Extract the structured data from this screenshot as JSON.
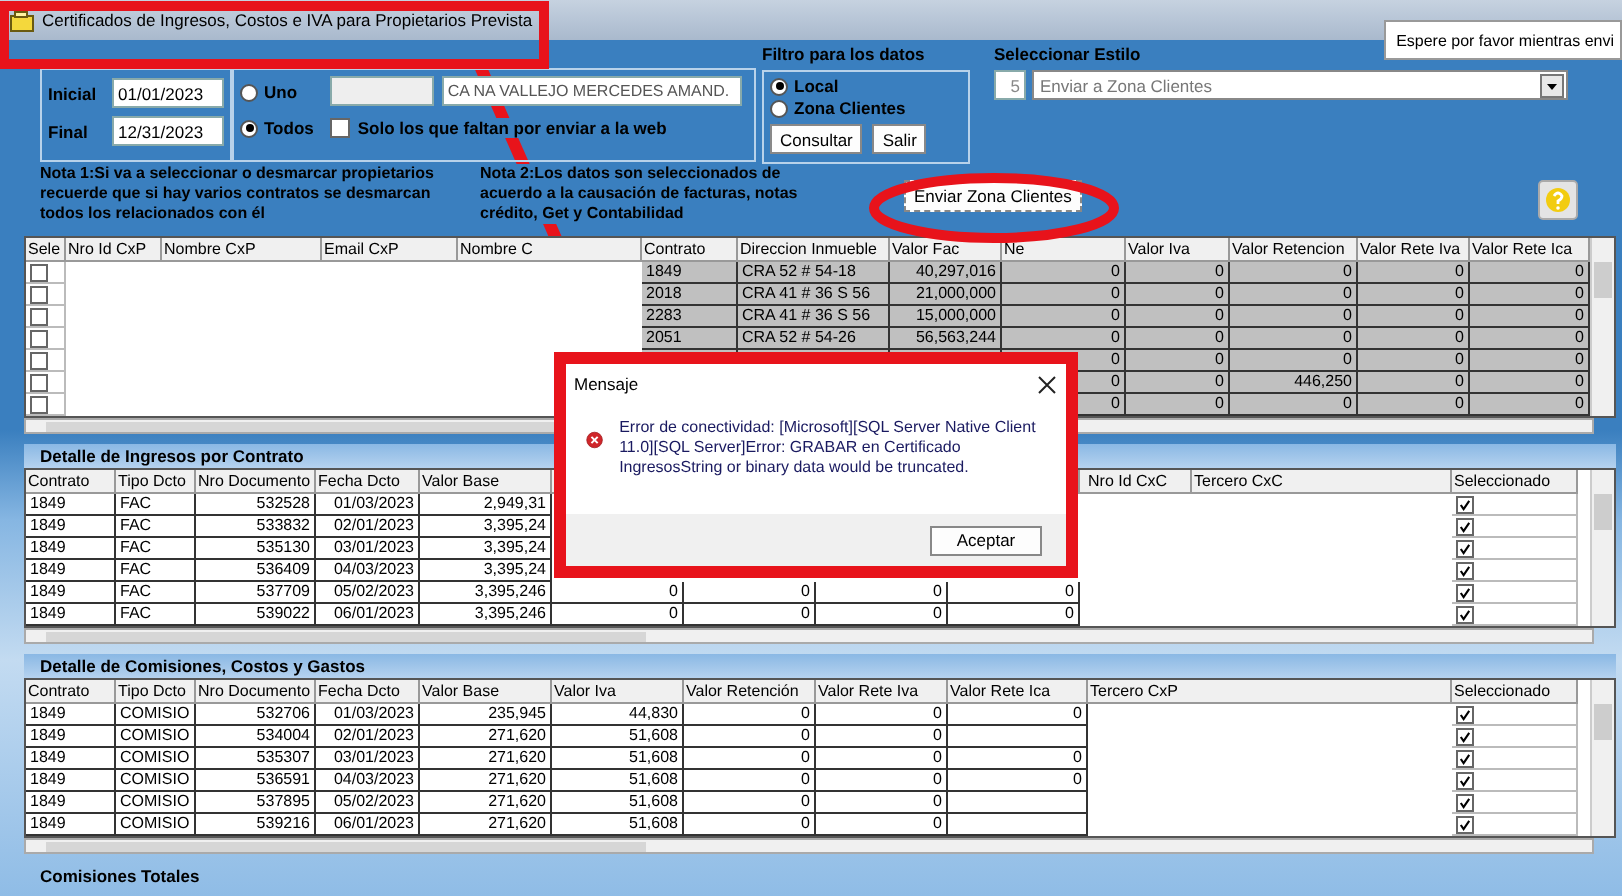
{
  "window": {
    "title": "Certificados de Ingresos, Costos e IVA para Propietarios Prevista"
  },
  "tooltip": "Espere por favor mientras envi",
  "dates": [
    {
      "label": "Inicial",
      "value": "01/01/2023"
    },
    {
      "label": "Final",
      "value": "12/31/2023"
    }
  ],
  "owner_scope": [
    {
      "label": "Uno",
      "selected": false
    },
    {
      "label": "Todos",
      "selected": true
    }
  ],
  "owner_name": {
    "value": "CA NA VALLEJO MERCEDES AMAND."
  },
  "pending_only": {
    "label": "Solo los que faltan  por enviar a la web",
    "checked": false
  },
  "filter": {
    "title": "Filtro para los datos",
    "options": [
      {
        "label": "Local",
        "selected": true
      },
      {
        "label": "Zona Clientes",
        "selected": false
      }
    ],
    "buttons": [
      "Consultar",
      "Salir"
    ]
  },
  "style": {
    "title": "Seleccionar Estilo",
    "number": "5",
    "value": "Enviar a Zona Clientes"
  },
  "notes": [
    "Nota 1:Si va a seleccionar o desmarcar propietarios recuerde que si hay varios contratos se desmarcan todos los relacionados con él",
    "Nota 2:Los datos son seleccionados de acuerdo a la causación de facturas, notas crédito, Get y Contabilidad"
  ],
  "send_button": "Enviar Zona Clientes",
  "owners_table": {
    "columns": [
      "Sele",
      "Nro Id CxP",
      "Nombre CxP",
      "Email CxP",
      "Nombre C",
      "Contrato",
      "Direccion Inmueble",
      "Valor Fac",
      "Ne",
      "Valor Iva",
      "Valor Retencion",
      "Valor Rete Iva",
      "Valor Rete Ica"
    ],
    "rows": [
      {
        "checked": false,
        "cells": [
          "",
          "",
          "",
          "",
          "",
          "1849",
          "CRA  52 # 54-18",
          "40,297,016",
          "0",
          "0",
          "0",
          "0",
          "0"
        ]
      },
      {
        "checked": false,
        "cells": [
          "",
          "",
          "",
          "",
          "",
          "2018",
          "CRA 41 # 36 S 56",
          "21,000,000",
          "0",
          "0",
          "0",
          "0",
          "0"
        ]
      },
      {
        "checked": false,
        "cells": [
          "",
          "",
          "",
          "",
          "",
          "2283",
          "CRA 41 # 36 S 56",
          "15,000,000",
          "0",
          "0",
          "0",
          "0",
          "0"
        ]
      },
      {
        "checked": false,
        "cells": [
          "",
          "",
          "",
          "",
          "",
          "2051",
          "CRA 52 # 54-26",
          "56,563,244",
          "0",
          "0",
          "0",
          "0",
          "0"
        ]
      },
      {
        "checked": false,
        "cells": [
          "",
          "",
          "",
          "",
          "",
          null,
          null,
          null,
          "0",
          "0",
          "0",
          "0",
          "0"
        ]
      },
      {
        "checked": false,
        "cells": [
          "",
          "",
          "",
          "",
          "",
          null,
          null,
          null,
          "0",
          "0",
          "446,250",
          "0",
          "0"
        ]
      },
      {
        "checked": false,
        "cells": [
          "",
          "",
          "",
          "",
          "",
          null,
          null,
          null,
          "0",
          "0",
          "0",
          "0",
          "0"
        ]
      }
    ]
  },
  "income_section": {
    "title": "Detalle de Ingresos por Contrato",
    "columns": [
      "Contrato",
      "Tipo Dcto",
      "Nro Documento",
      "Fecha Dcto",
      "Valor Base",
      null,
      null,
      null,
      null,
      "Nro Id CxC",
      "Tercero CxC",
      "Seleccionado"
    ],
    "rows": [
      {
        "checked": true,
        "cells": [
          "1849",
          "FAC",
          "532528",
          "01/03/2023",
          "2,949,31",
          null,
          null,
          null,
          null,
          "",
          ""
        ]
      },
      {
        "checked": true,
        "cells": [
          "1849",
          "FAC",
          "533832",
          "02/01/2023",
          "3,395,24",
          null,
          null,
          null,
          null,
          "",
          ""
        ]
      },
      {
        "checked": true,
        "cells": [
          "1849",
          "FAC",
          "535130",
          "03/01/2023",
          "3,395,24",
          null,
          null,
          null,
          null,
          "",
          ""
        ]
      },
      {
        "checked": true,
        "cells": [
          "1849",
          "FAC",
          "536409",
          "04/03/2023",
          "3,395,24",
          null,
          null,
          null,
          null,
          "",
          ""
        ]
      },
      {
        "checked": true,
        "cells": [
          "1849",
          "FAC",
          "537709",
          "05/02/2023",
          "3,395,246",
          "0",
          "0",
          "0",
          "0",
          "",
          ""
        ]
      },
      {
        "checked": true,
        "cells": [
          "1849",
          "FAC",
          "539022",
          "06/01/2023",
          "3,395,246",
          "0",
          "0",
          "0",
          "0",
          "",
          ""
        ]
      }
    ]
  },
  "costs_section": {
    "title": "Detalle de Comisiones, Costos y Gastos",
    "columns": [
      "Contrato",
      "Tipo Dcto",
      "Nro Documento",
      "Fecha Dcto",
      "Valor Base",
      "Valor Iva",
      "Valor Retención",
      "Valor Rete Iva",
      "Valor Rete Ica",
      "Tercero CxP",
      "Seleccionado"
    ],
    "rows": [
      {
        "checked": true,
        "cells": [
          "1849",
          "COMISIO",
          "532706",
          "01/03/2023",
          "235,945",
          "44,830",
          "0",
          "0",
          "0",
          ""
        ]
      },
      {
        "checked": true,
        "cells": [
          "1849",
          "COMISIO",
          "534004",
          "02/01/2023",
          "271,620",
          "51,608",
          "0",
          "0",
          "",
          ""
        ]
      },
      {
        "checked": true,
        "cells": [
          "1849",
          "COMISIO",
          "535307",
          "03/01/2023",
          "271,620",
          "51,608",
          "0",
          "0",
          "0",
          ""
        ]
      },
      {
        "checked": true,
        "cells": [
          "1849",
          "COMISIO",
          "536591",
          "04/03/2023",
          "271,620",
          "51,608",
          "0",
          "0",
          "0",
          ""
        ]
      },
      {
        "checked": true,
        "cells": [
          "1849",
          "COMISIO",
          "537895",
          "05/02/2023",
          "271,620",
          "51,608",
          "0",
          "0",
          "",
          ""
        ]
      },
      {
        "checked": true,
        "cells": [
          "1849",
          "COMISIO",
          "539216",
          "06/01/2023",
          "271,620",
          "51,608",
          "0",
          "0",
          "",
          ""
        ]
      }
    ]
  },
  "totals_title": "Comisiones Totales",
  "dialog": {
    "title": "Mensaje",
    "message": "Error de conectividad: [Microsoft][SQL Server Native Client 11.0][SQL Server]Error: GRABAR en Certificado IngresosString or binary data would be truncated.",
    "button": "Aceptar"
  }
}
